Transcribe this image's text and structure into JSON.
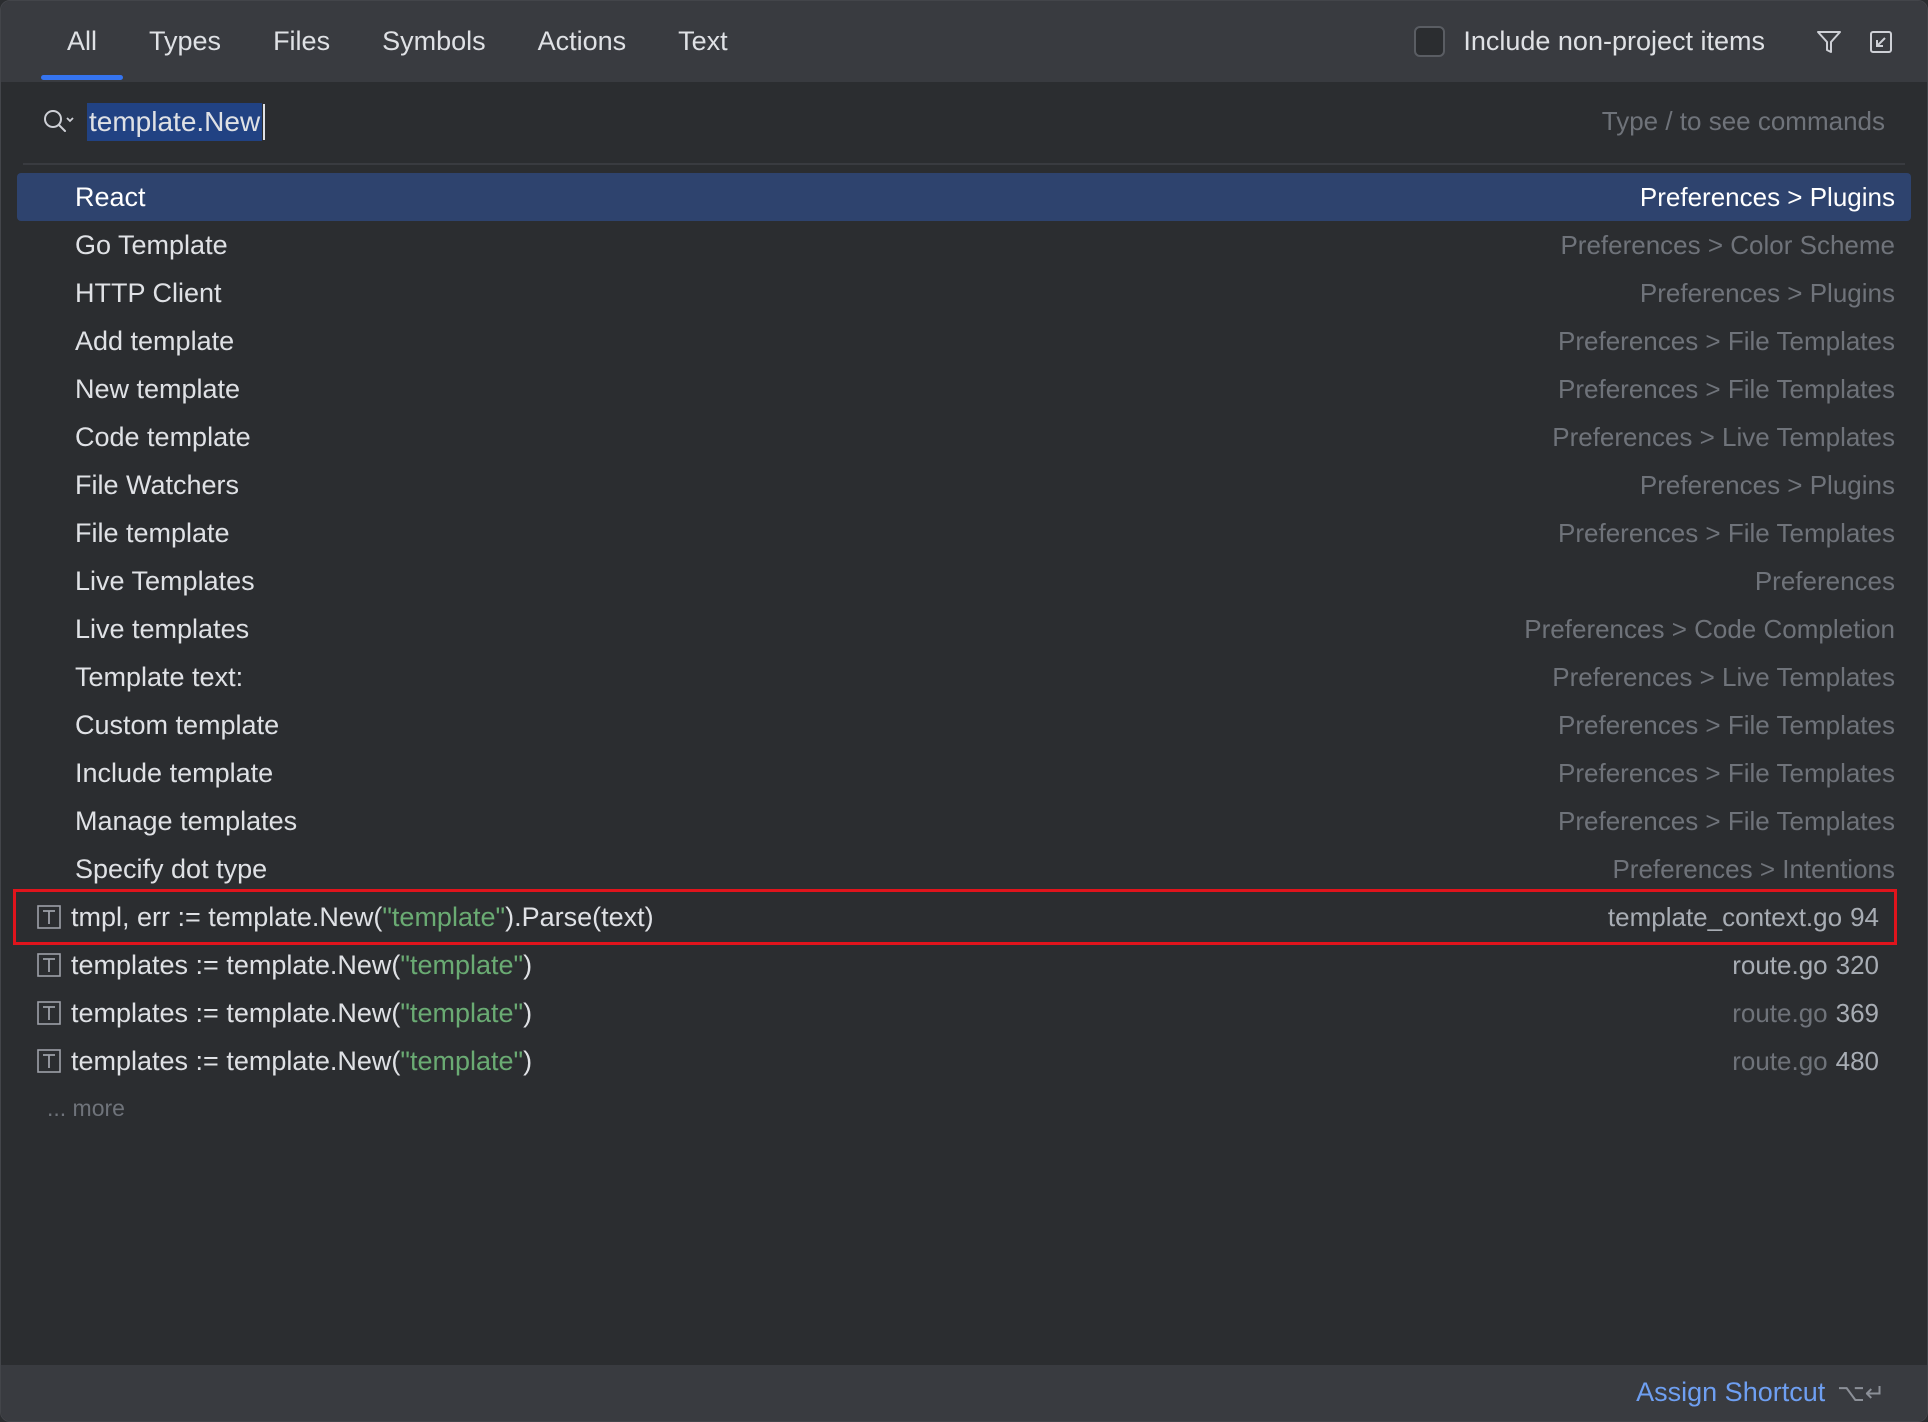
{
  "tabs": [
    {
      "label": "All"
    },
    {
      "label": "Types"
    },
    {
      "label": "Files"
    },
    {
      "label": "Symbols"
    },
    {
      "label": "Actions"
    },
    {
      "label": "Text"
    }
  ],
  "active_tab": "All",
  "include_non_project": {
    "label": "Include non-project items",
    "checked": false
  },
  "icons": {
    "filter": "filter-icon",
    "open_in_window": "open-in-window-icon",
    "search": "search-icon",
    "text_item": "text-file-icon"
  },
  "search": {
    "value": "template.New",
    "hint": "Type / to see commands"
  },
  "settings_results": [
    {
      "title": "React",
      "path": "Preferences > Plugins",
      "selected": true
    },
    {
      "title": "Go Template",
      "path": "Preferences > Color Scheme"
    },
    {
      "title": "HTTP Client",
      "path": "Preferences > Plugins"
    },
    {
      "title": "Add template",
      "path": "Preferences > File Templates"
    },
    {
      "title": "New template",
      "path": "Preferences > File Templates"
    },
    {
      "title": "Code template",
      "path": "Preferences > Live Templates"
    },
    {
      "title": "File Watchers",
      "path": "Preferences > Plugins"
    },
    {
      "title": "File template",
      "path": "Preferences > File Templates"
    },
    {
      "title": "Live Templates",
      "path": "Preferences"
    },
    {
      "title": "Live templates",
      "path": "Preferences > Code Completion"
    },
    {
      "title": "Template text:",
      "path": "Preferences > Live Templates"
    },
    {
      "title": "Custom template",
      "path": "Preferences > File Templates"
    },
    {
      "title": "Include template",
      "path": "Preferences > File Templates"
    },
    {
      "title": "Manage templates",
      "path": "Preferences > File Templates"
    },
    {
      "title": "Specify dot type",
      "path": "Preferences > Intentions"
    }
  ],
  "text_results": [
    {
      "prefix": "tmpl, err := template.New(",
      "string": "\"template\"",
      "suffix": ").Parse(text)",
      "file": "template_context.go",
      "line": "94"
    },
    {
      "prefix": "templates := template.New(",
      "string": "\"template\"",
      "suffix": ")",
      "file": "route.go",
      "line": "320"
    },
    {
      "prefix": "templates := template.New(",
      "string": "\"template\"",
      "suffix": ")",
      "file": "route.go",
      "line": "369"
    },
    {
      "prefix": "templates := template.New(",
      "string": "\"template\"",
      "suffix": ")",
      "file": "route.go",
      "line": "480"
    }
  ],
  "more_label": "... more",
  "footer": {
    "assign_label": "Assign Shortcut",
    "assign_keys": "⌥↵"
  },
  "colors": {
    "accent": "#3574f0",
    "selection": "#2e436e",
    "string": "#6aab73",
    "link": "#6e9ff2",
    "highlight_box": "#e0141c"
  }
}
